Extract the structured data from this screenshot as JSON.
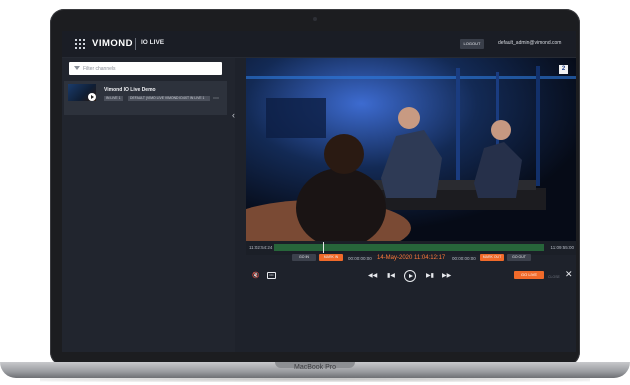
{
  "device": {
    "model_label": "MacBook Pro"
  },
  "header": {
    "logo": "VIMOND",
    "product": "IO LIVE",
    "logout_label": "LOGOUT",
    "user_email": "default_admin@vimond.com"
  },
  "sidebar": {
    "filter_placeholder": "Filter channels",
    "channels": [
      {
        "name": "Vimond IO Live Demo",
        "tag_primary": "IN LIVE 1",
        "tag_secondary": "DEFAULT (VIMO LIVE VIMOND ID4XT IN LIVE 1"
      }
    ]
  },
  "player": {
    "channel_badge": "2",
    "timeline_start": "11:02:54:24",
    "timeline_end": "11:09:55:00",
    "timeline_progress": 0.18,
    "mark_row": {
      "go_in_label": "GO IN",
      "mark_in_label": "MARK IN",
      "in_time": "00:00:00:00",
      "current_datetime": "14-May-2020 11:04:12:17",
      "out_time": "00:00:00:00",
      "mark_out_label": "MARK OUT",
      "go_out_label": "GO OUT"
    },
    "controls": {
      "go_live_label": "GO LIVE",
      "close_label": "CLOSE"
    }
  },
  "colors": {
    "accent": "#f06a2a",
    "timeline": "#27653a",
    "app_background": "#1e222b"
  }
}
